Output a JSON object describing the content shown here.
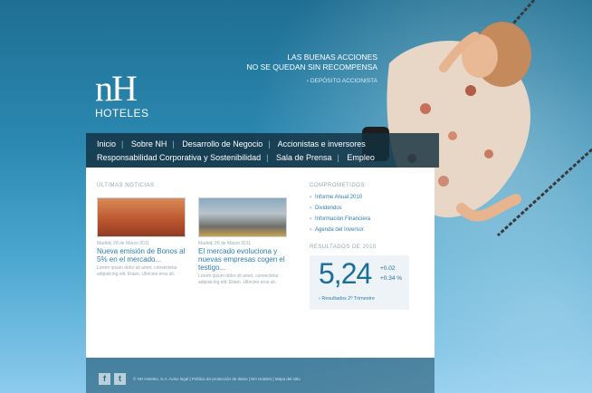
{
  "brand": {
    "logo_mark": "nH",
    "logo_sub": "HOTELES"
  },
  "promo": {
    "line1": "LAS BUENAS ACCIONES",
    "line2": "NO SE QUEDAN SIN RECOMPENSA",
    "link": "DEPÓSITO ACCIONISTA"
  },
  "nav": {
    "row1": [
      "Inicio",
      "Sobre NH",
      "Desarrollo de Negocio",
      "Accionistas e inversores"
    ],
    "row2": [
      "Responsabilidad Corporativa y Sostenibilidad",
      "Sala de Prensa",
      "Empleo"
    ]
  },
  "news": {
    "section_title": "ÚLTIMAS NOTICIAS",
    "items": [
      {
        "date": "Madrid, 28 de Marzo 2011",
        "headline": "Nueva emisión de Bonos al 5% en el mercado...",
        "body": "Lorem ipsum dolor sit amet, consectetur adipisicing elit. Etiam. Ultricies eros sit."
      },
      {
        "date": "Madrid, 26 de Marzo 2011",
        "headline": "El mercado evoluciona y nuevas empresas cogen el testigo...",
        "body": "Lorem ipsum dolor sit amet, consectetur adipisicing elit. Etiam. Ultricies eros sit."
      }
    ]
  },
  "commitments": {
    "section_title": "COMPROMETIDOS",
    "links": [
      "Informe Anual 2010",
      "Dividendos",
      "Información Financiera",
      "Agenda del Inversor"
    ]
  },
  "results": {
    "section_title": "RESULTADOS DE 2010",
    "value": "5,24",
    "delta1": "+0.02",
    "delta2": "+0.34 %",
    "link": "Resultados 2º Trimestre"
  },
  "footer": {
    "facebook": "f",
    "twitter": "t",
    "text": "© NH Hoteles, S.A. Aviso legal | Política de protección de datos | NH Hoteles | Mapa del sitio"
  },
  "colors": {
    "accent": "#2a7fb0",
    "nav_bg": "#143040",
    "sky": "#2b88b1"
  }
}
